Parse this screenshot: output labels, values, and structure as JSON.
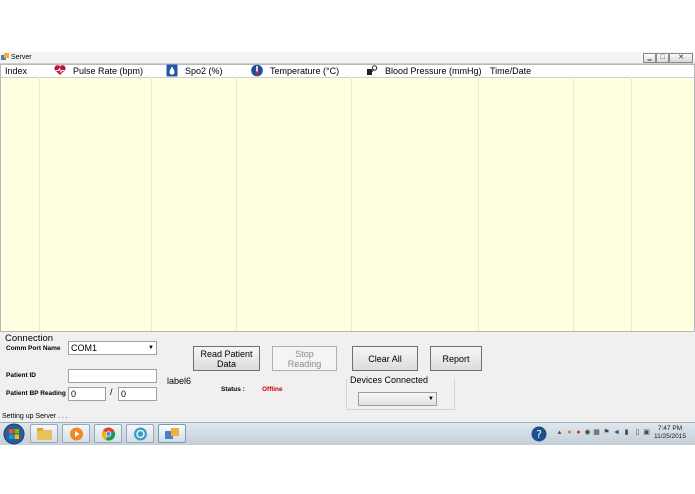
{
  "window": {
    "title": "Server",
    "minimize": "‗",
    "maximize": "□",
    "close": "✕"
  },
  "grid": {
    "columns": [
      "Index",
      "Pulse Rate (bpm)",
      "Spo2 (%)",
      "Temperature (°C)",
      "Blood Pressure (mmHg)",
      "Time/Date"
    ]
  },
  "connection": {
    "group_title": "Connection",
    "comm_port_label": "Comm Port Name",
    "comm_port_value": "COM1",
    "patient_id_label": "Patient ID",
    "patient_id_value": "",
    "bp_label": "Patient BP Reading",
    "bp_systolic": "0",
    "bp_separator": "/",
    "bp_diastolic": "0"
  },
  "buttons": {
    "read_patient_data": "Read Patient Data",
    "stop_reading": "Stop Reading",
    "clear_all": "Clear All",
    "report": "Report"
  },
  "info": {
    "label6": "label6",
    "status_label": "Status :",
    "status_value": "Offline",
    "status_color": "#cc0000",
    "devices_connected": "Devices Connected",
    "devices_value": ""
  },
  "statusbar": {
    "text": "Setting up Server . . ."
  },
  "taskbar": {
    "clock_time": "7:47 PM",
    "clock_date": "11/25/2015"
  }
}
